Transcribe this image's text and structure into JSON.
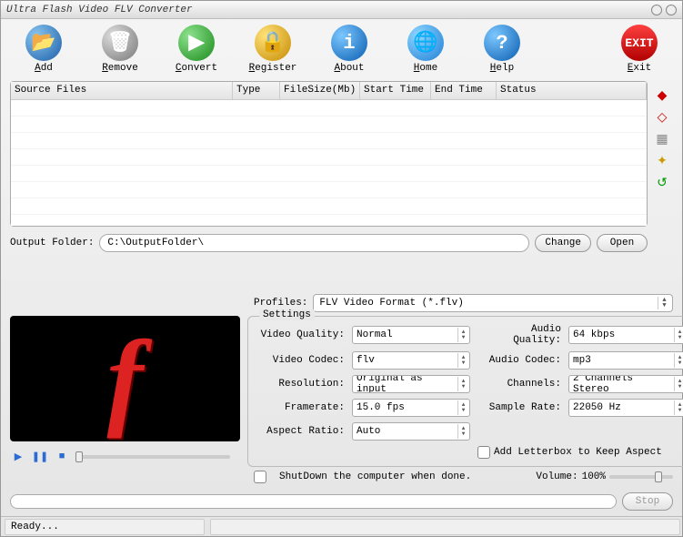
{
  "window": {
    "title": "Ultra Flash Video FLV Converter"
  },
  "toolbar": [
    {
      "id": "add",
      "label": "Add",
      "underlined": "A",
      "rest": "dd"
    },
    {
      "id": "remove",
      "label": "Remove",
      "underlined": "R",
      "rest": "emove"
    },
    {
      "id": "convert",
      "label": "Convert",
      "underlined": "C",
      "rest": "onvert"
    },
    {
      "id": "register",
      "label": "Register",
      "underlined": "R",
      "rest": "egister"
    },
    {
      "id": "about",
      "label": "About",
      "underlined": "A",
      "rest": "bout"
    },
    {
      "id": "home",
      "label": "Home",
      "underlined": "H",
      "rest": "ome"
    },
    {
      "id": "help",
      "label": "Help",
      "underlined": "H",
      "rest": "elp"
    },
    {
      "id": "exit",
      "label": "Exit",
      "underlined": "E",
      "rest": "xit"
    }
  ],
  "columns": [
    "Source Files",
    "Type",
    "FileSize(Mb)",
    "Start Time",
    "End Time",
    "Status"
  ],
  "output": {
    "label": "Output Folder:",
    "value": "C:\\OutputFolder\\",
    "change": "Change",
    "open": "Open"
  },
  "profiles": {
    "label": "Profiles:",
    "value": "FLV Video Format (*.flv)"
  },
  "settings": {
    "legend": "Settings",
    "video_quality": {
      "label": "Video Quality:",
      "value": "Normal"
    },
    "video_codec": {
      "label": "Video Codec:",
      "value": "flv"
    },
    "resolution": {
      "label": "Resolution:",
      "value": "Original as input"
    },
    "framerate": {
      "label": "Framerate:",
      "value": "15.0   fps"
    },
    "aspect": {
      "label": "Aspect Ratio:",
      "value": "Auto"
    },
    "audio_quality": {
      "label": "Audio Quality:",
      "value": "64  kbps"
    },
    "audio_codec": {
      "label": "Audio Codec:",
      "value": "mp3"
    },
    "channels": {
      "label": "Channels:",
      "value": "2 Channels Stereo"
    },
    "sample_rate": {
      "label": "Sample Rate:",
      "value": "22050 Hz"
    },
    "letterbox": "Add Letterbox to Keep Aspect"
  },
  "shutdown": "ShutDown the computer when done.",
  "volume": {
    "label": "Volume:",
    "value": "100%"
  },
  "stop": "Stop",
  "status": "Ready..."
}
